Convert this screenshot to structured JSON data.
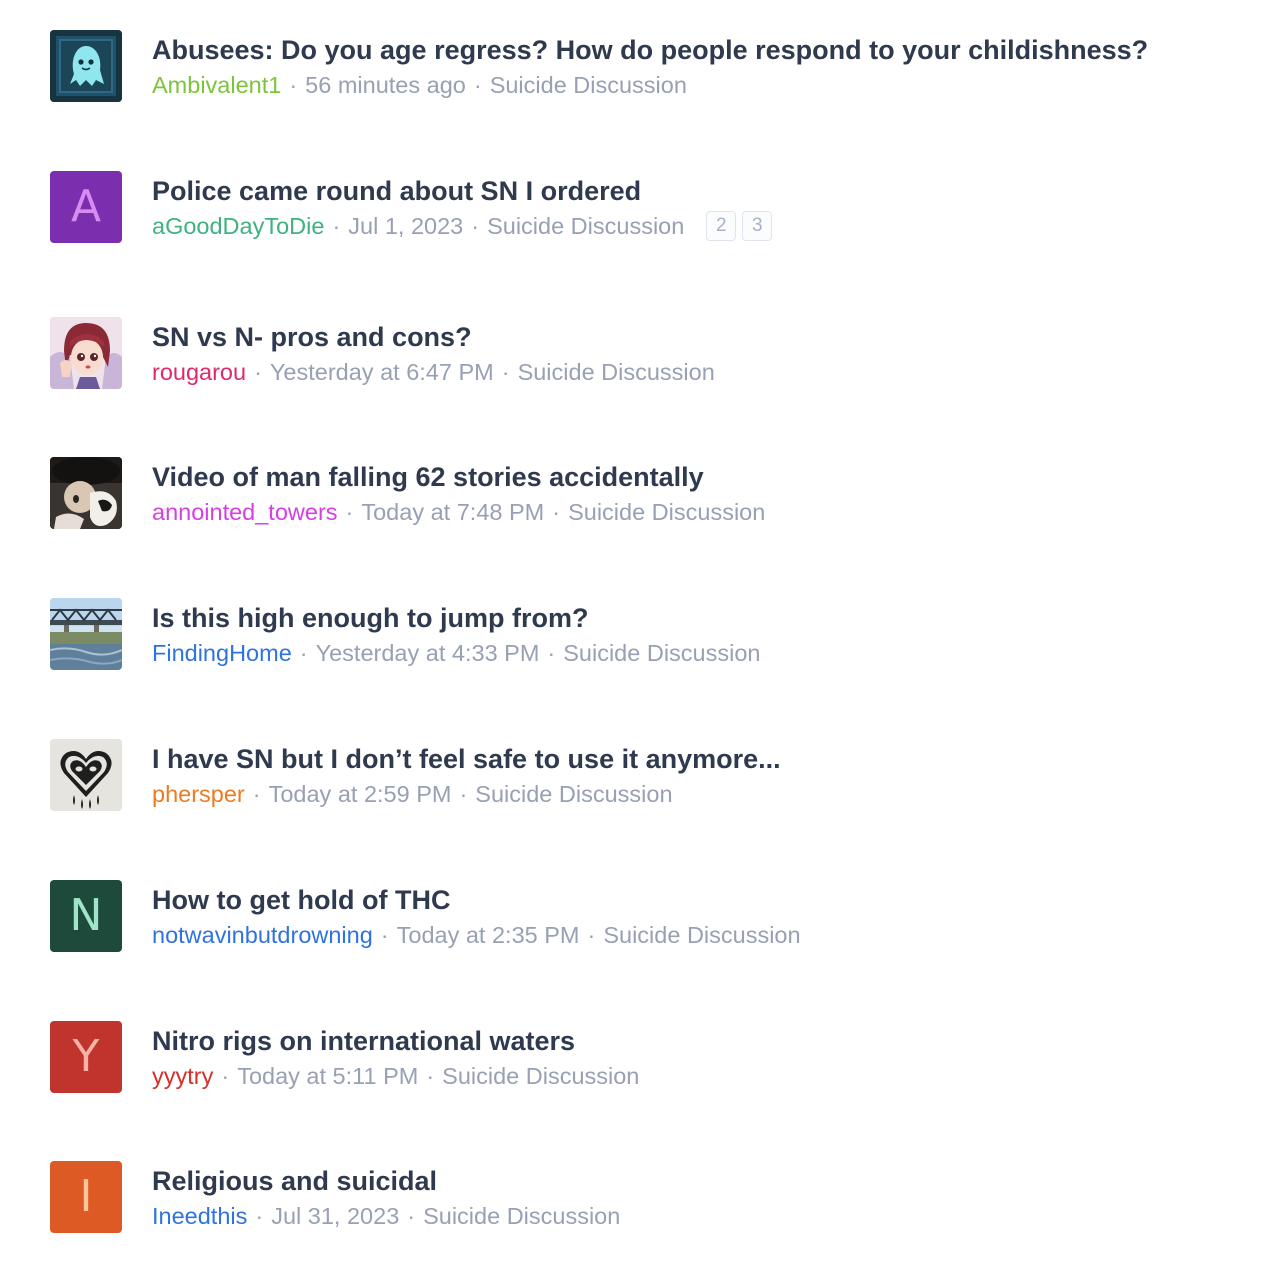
{
  "threads": [
    {
      "title": "Abusees: Do you age regress? How do people respond to your childishness?",
      "author": "Ambivalent1",
      "author_color": "#7cc43a",
      "date": "56 minutes ago",
      "forum": "Suicide Discussion",
      "avatar": {
        "type": "image",
        "icon": "ghost-avatar-image"
      }
    },
    {
      "title": "Police came round about SN I ordered",
      "author": "aGoodDayToDie",
      "author_color": "#3fb27f",
      "date": "Jul 1, 2023",
      "forum": "Suicide Discussion",
      "avatar": {
        "type": "letter",
        "letter": "A",
        "bg": "#7b2faf",
        "fg": "#d98cf0"
      },
      "pages": [
        "2",
        "3"
      ]
    },
    {
      "title": "SN vs N- pros and cons?",
      "author": "rougarou",
      "author_color": "#e0296d",
      "date": "Yesterday at 6:47 PM",
      "forum": "Suicide Discussion",
      "avatar": {
        "type": "image",
        "icon": "anime-girl-avatar-image"
      }
    },
    {
      "title": "Video of man falling 62 stories accidentally",
      "author": "annointed_towers",
      "author_color": "#d63ee6",
      "date": "Today at 7:48 PM",
      "forum": "Suicide Discussion",
      "avatar": {
        "type": "image",
        "icon": "plush-doll-avatar-image"
      }
    },
    {
      "title": "Is this high enough to jump from?",
      "author": "FindingHome",
      "author_color": "#2f73e0",
      "date": "Yesterday at 4:33 PM",
      "forum": "Suicide Discussion",
      "avatar": {
        "type": "image",
        "icon": "bridge-avatar-image"
      }
    },
    {
      "title": "I have SN but I don’t feel safe to use it anymore...",
      "author": "phersper",
      "author_color": "#ee7a22",
      "date": "Today at 2:59 PM",
      "forum": "Suicide Discussion",
      "avatar": {
        "type": "image",
        "icon": "crying-heart-avatar-image"
      }
    },
    {
      "title": "How to get hold of THC",
      "author": "notwavinbutdrowning",
      "author_color": "#2f73e0",
      "date": "Today at 2:35 PM",
      "forum": "Suicide Discussion",
      "avatar": {
        "type": "letter",
        "letter": "N",
        "bg": "#1e4a3c",
        "fg": "#9fe6c9"
      }
    },
    {
      "title": "Nitro rigs on international waters",
      "author": "yyytry",
      "author_color": "#d6302a",
      "date": "Today at 5:11 PM",
      "forum": "Suicide Discussion",
      "avatar": {
        "type": "letter",
        "letter": "Y",
        "bg": "#c1342e",
        "fg": "#f6b3a6"
      }
    },
    {
      "title": "Religious and suicidal",
      "author": "Ineedthis",
      "author_color": "#2f73e0",
      "date": "Jul 31, 2023",
      "forum": "Suicide Discussion",
      "avatar": {
        "type": "letter",
        "letter": "I",
        "bg": "#dd5a25",
        "fg": "#f9c79a"
      }
    }
  ]
}
